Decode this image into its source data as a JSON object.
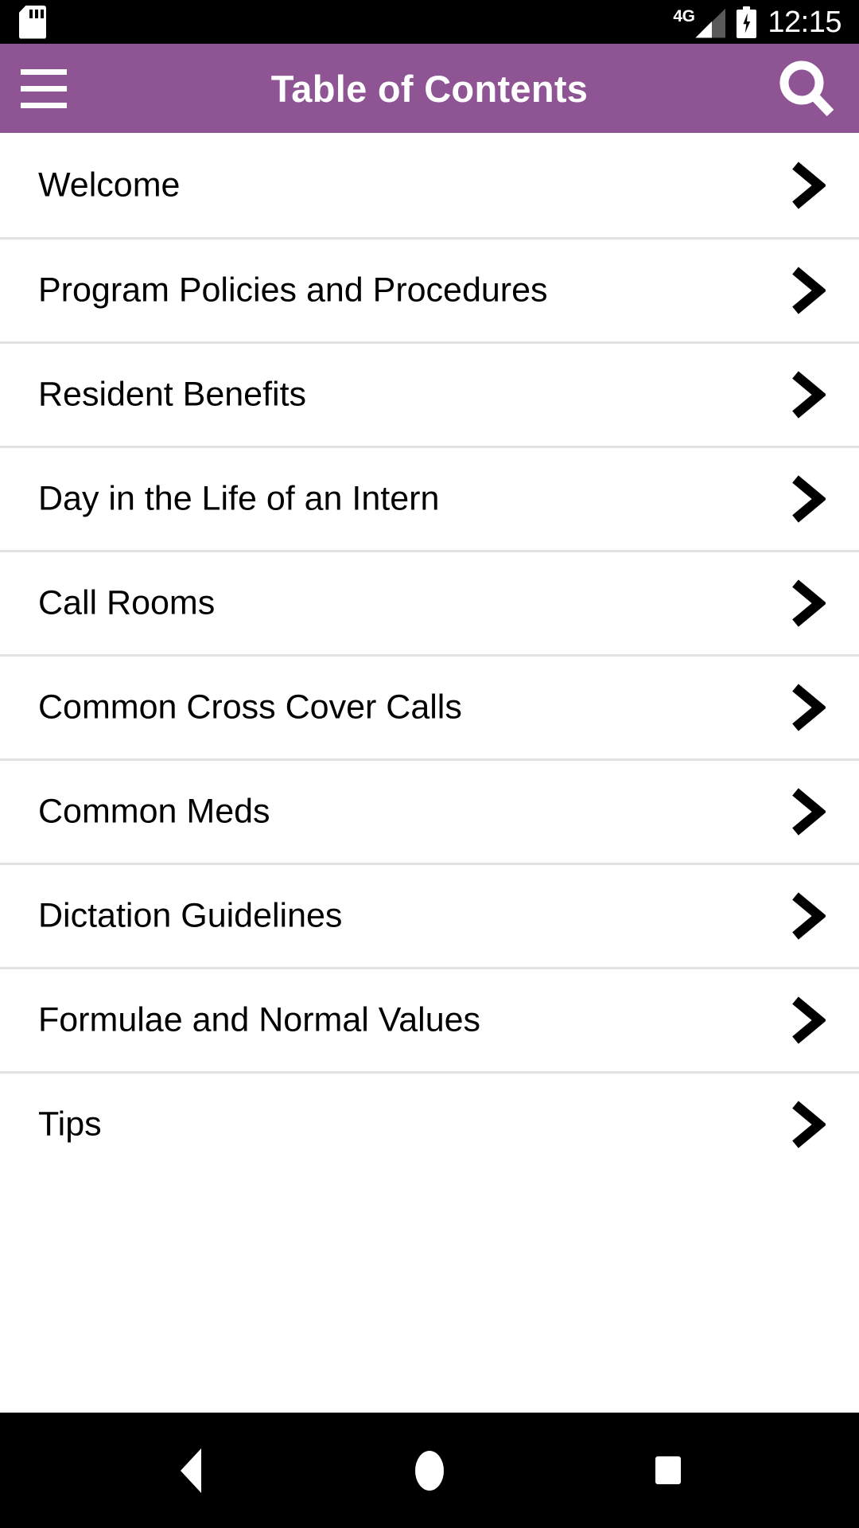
{
  "status_bar": {
    "sdcard_icon": "sd-card-icon",
    "network_label": "4G",
    "signal_icon": "signal-bars-icon",
    "battery_icon": "battery-charging-icon",
    "time": "12:15",
    "background_color": "#000000"
  },
  "app_bar": {
    "title": "Table of Contents",
    "menu_icon": "hamburger-menu-icon",
    "search_icon": "search-icon",
    "background_color": "#8e5494",
    "text_color": "#ffffff"
  },
  "toc": {
    "chevron_icon": "chevron-right-icon",
    "divider_color": "#e2e2e2",
    "items": [
      {
        "label": "Welcome"
      },
      {
        "label": "Program Policies and Procedures"
      },
      {
        "label": "Resident Benefits"
      },
      {
        "label": "Day in the Life of an Intern"
      },
      {
        "label": "Call Rooms"
      },
      {
        "label": "Common Cross Cover Calls"
      },
      {
        "label": "Common Meds"
      },
      {
        "label": "Dictation Guidelines"
      },
      {
        "label": "Formulae and Normal Values"
      },
      {
        "label": "Tips"
      }
    ]
  },
  "nav_bar": {
    "back_icon": "back-triangle-icon",
    "home_icon": "home-circle-icon",
    "recents_icon": "recents-square-icon",
    "background_color": "#000000"
  }
}
